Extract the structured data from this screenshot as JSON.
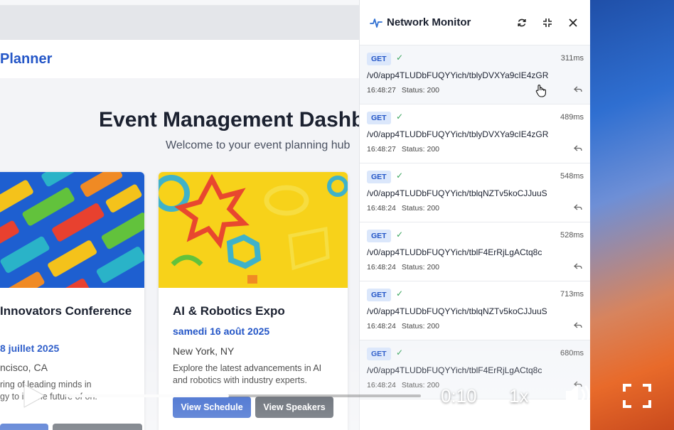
{
  "app": {
    "brand": "Planner",
    "dashboard_title": "Event Management Dashb",
    "dashboard_subtitle": "Welcome to your event planning hub"
  },
  "cards": [
    {
      "title": "Innovators Conference",
      "date": "8 juillet 2025",
      "location": "ncisco, CA",
      "description": "ring of leading minds in gy to iss the future of on."
    },
    {
      "title": "AI & Robotics Expo",
      "date": "samedi 16 août 2025",
      "location": "New York, NY",
      "description": "Explore the latest advancements in AI and robotics with industry experts.",
      "buttons": [
        "View Schedule",
        "View Speakers"
      ]
    }
  ],
  "network_monitor": {
    "title": "Network Monitor",
    "icons": [
      "activity-icon",
      "refresh-icon",
      "collapse-icon",
      "close-icon"
    ],
    "requests": [
      {
        "method": "GET",
        "duration": "311ms",
        "url": "/v0/app4TLUDbFUQYYich/tblyDVXYa9cIE4zGR",
        "time": "16:48:27",
        "status": "Status: 200"
      },
      {
        "method": "GET",
        "duration": "489ms",
        "url": "/v0/app4TLUDbFUQYYich/tblyDVXYa9cIE4zGR",
        "time": "16:48:27",
        "status": "Status: 200"
      },
      {
        "method": "GET",
        "duration": "548ms",
        "url": "/v0/app4TLUDbFUQYYich/tblqNZTv5koCJJuuS",
        "time": "16:48:24",
        "status": "Status: 200"
      },
      {
        "method": "GET",
        "duration": "528ms",
        "url": "/v0/app4TLUDbFUQYYich/tblF4ErRjLgACtq8c",
        "time": "16:48:24",
        "status": "Status: 200"
      },
      {
        "method": "GET",
        "duration": "713ms",
        "url": "/v0/app4TLUDbFUQYYich/tblqNZTv5koCJJuuS",
        "time": "16:48:24",
        "status": "Status: 200"
      },
      {
        "method": "GET",
        "duration": "680ms",
        "url": "/v0/app4TLUDbFUQYYich/tblF4ErRjLgACtq8c",
        "time": "16:48:24",
        "status": "Status: 200"
      }
    ]
  },
  "player": {
    "time": "0:10",
    "speed": "1x",
    "progress": 0.46
  },
  "colors": {
    "brand_blue": "#2456c7",
    "method_badge_bg": "#dbe7fb",
    "success_green": "#3aa55d",
    "button_dark": "#4b525c"
  }
}
